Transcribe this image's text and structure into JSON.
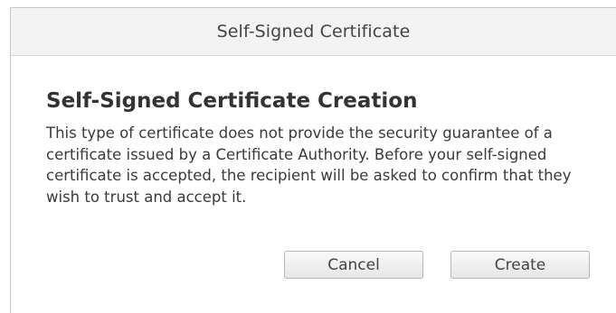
{
  "dialog": {
    "title": "Self-Signed Certificate",
    "heading": "Self-Signed Certificate Creation",
    "message": "This type of certificate does not provide the security guarantee of a certificate issued by a Certificate Authority. Before your self-signed certificate is accepted, the recipient will be asked to confirm that they wish to trust and accept it.",
    "buttons": {
      "cancel_label": "Cancel",
      "create_label": "Create"
    }
  }
}
